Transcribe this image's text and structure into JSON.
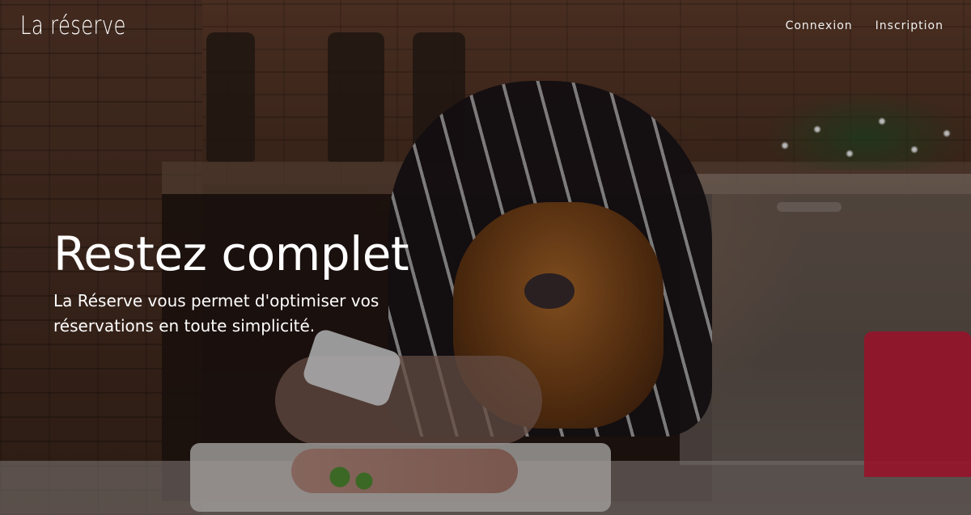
{
  "brand": {
    "name": "La réserve"
  },
  "nav": {
    "items": [
      {
        "label": "Connexion"
      },
      {
        "label": "Inscription"
      }
    ]
  },
  "hero": {
    "title": "Restez complet",
    "subtitle": "La Réserve vous permet d'optimiser vos réservations en toute simplicité."
  },
  "colors": {
    "text": "#ffffff",
    "overlay": "#000000"
  }
}
